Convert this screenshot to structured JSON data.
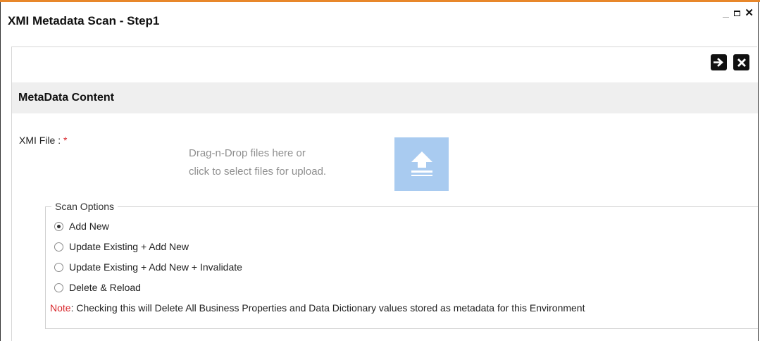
{
  "window": {
    "title": "XMI Metadata Scan - Step1"
  },
  "toolbar": {
    "next_icon": "arrow-right-icon",
    "close_icon": "close-icon"
  },
  "section": {
    "title": "MetaData Content"
  },
  "upload": {
    "label": "XMI File : ",
    "required_mark": "*",
    "drop_line1": "Drag-n-Drop files here or",
    "drop_line2": "click to select files for upload.",
    "icon": "upload-icon"
  },
  "scan_options": {
    "legend": "Scan Options",
    "options": [
      {
        "label": "Add New",
        "checked": true
      },
      {
        "label": "Update Existing + Add New",
        "checked": false
      },
      {
        "label": "Update Existing + Add New + Invalidate",
        "checked": false
      },
      {
        "label": "Delete & Reload",
        "checked": false
      }
    ],
    "note_label": "Note",
    "note_text": ": Checking this will Delete All Business Properties and Data Dictionary values stored as metadata for this Environment"
  },
  "colors": {
    "accent": "#e8872a",
    "required": "#d9262b",
    "upload_tile": "#a9cbf0"
  }
}
